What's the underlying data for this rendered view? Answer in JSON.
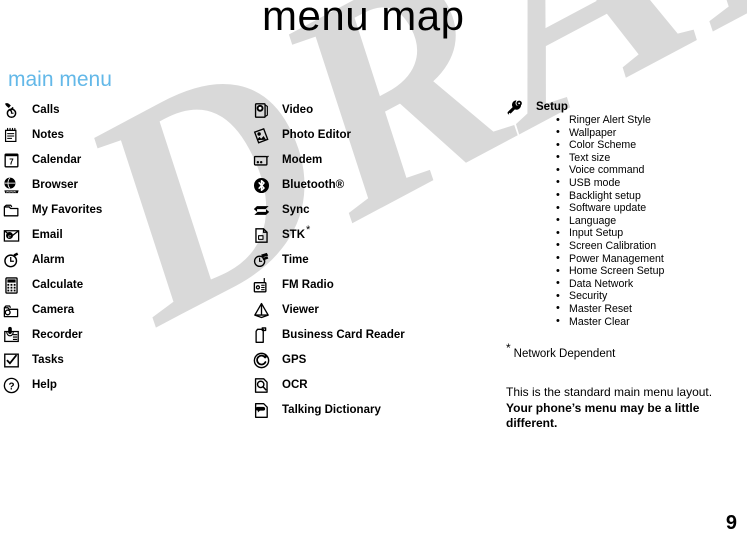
{
  "page": {
    "title": "menu map",
    "section_heading": "main menu",
    "page_number": "9",
    "watermark": "DRAFT",
    "accent_color": "#63b8e8",
    "watermark_color": "#d9d9d9",
    "text_color": "#000000"
  },
  "columns": [
    {
      "id": "column-1",
      "items": [
        {
          "label": "Calls",
          "icon": "calls-icon"
        },
        {
          "label": "Notes",
          "icon": "notes-icon"
        },
        {
          "label": "Calendar",
          "icon": "calendar-icon"
        },
        {
          "label": "Browser",
          "icon": "browser-icon"
        },
        {
          "label": "My Favorites",
          "icon": "my-favorites-icon"
        },
        {
          "label": "Email",
          "icon": "email-icon"
        },
        {
          "label": "Alarm",
          "icon": "alarm-icon"
        },
        {
          "label": "Calculate",
          "icon": "calculate-icon"
        },
        {
          "label": "Camera",
          "icon": "camera-icon"
        },
        {
          "label": "Recorder",
          "icon": "recorder-icon"
        },
        {
          "label": "Tasks",
          "icon": "tasks-icon"
        },
        {
          "label": "Help",
          "icon": "help-icon"
        }
      ]
    },
    {
      "id": "column-2",
      "items": [
        {
          "label": "Video",
          "icon": "video-icon"
        },
        {
          "label": "Photo Editor",
          "icon": "photo-editor-icon"
        },
        {
          "label": "Modem",
          "icon": "modem-icon"
        },
        {
          "label": "Bluetooth®",
          "icon": "bluetooth-icon"
        },
        {
          "label": "Sync",
          "icon": "sync-icon"
        },
        {
          "label": "STK",
          "icon": "stk-icon",
          "footnote_marker": "*"
        },
        {
          "label": "Time",
          "icon": "time-icon"
        },
        {
          "label": "FM Radio",
          "icon": "fm-radio-icon"
        },
        {
          "label": "Viewer",
          "icon": "viewer-icon"
        },
        {
          "label": "Business Card Reader",
          "icon": "business-card-reader-icon"
        },
        {
          "label": "GPS",
          "icon": "gps-icon"
        },
        {
          "label": "OCR",
          "icon": "ocr-icon"
        },
        {
          "label": "Talking Dictionary",
          "icon": "talking-dictionary-icon"
        }
      ]
    }
  ],
  "setup": {
    "label": "Setup",
    "icon": "setup-wrench-gear-icon",
    "sub_items": [
      "Ringer Alert Style",
      "Wallpaper",
      "Color Scheme",
      "Text size",
      "Voice command",
      "USB mode",
      "Backlight setup",
      "Software update",
      "Language",
      "Input Setup",
      "Screen Calibration",
      "Power Management",
      "Home Screen Setup",
      "Data Network",
      "Security",
      "Master Reset",
      "Master Clear"
    ]
  },
  "footnote": {
    "marker": "*",
    "text": "Network Dependent"
  },
  "note": {
    "line_1": "This is the standard main menu layout.",
    "line_2": "Your phone’s menu may be a little different."
  }
}
